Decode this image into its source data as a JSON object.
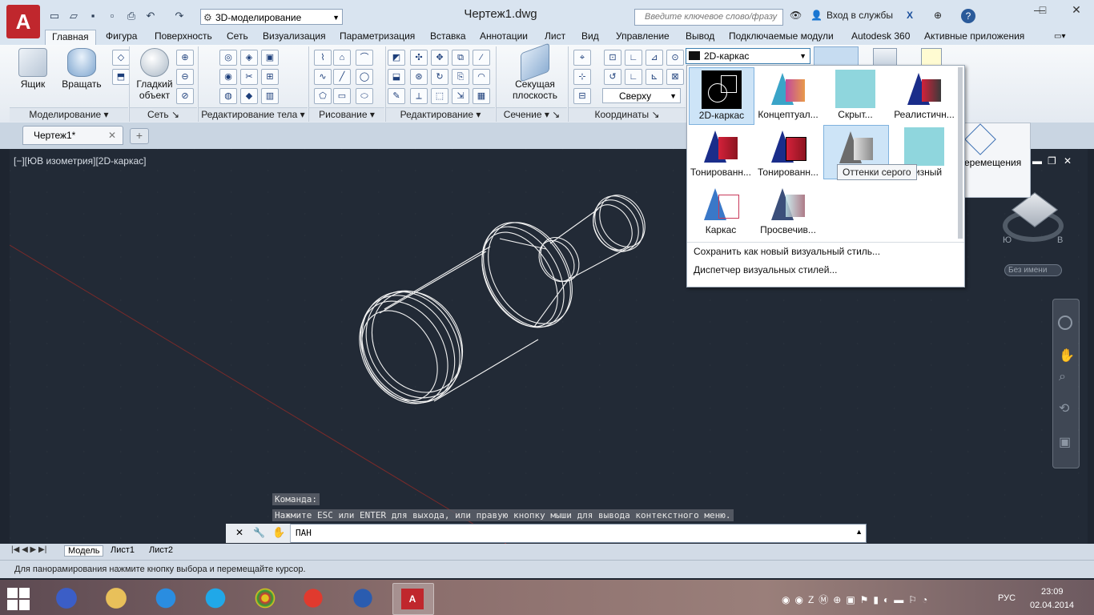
{
  "titlebar": {
    "workspace": "3D-моделирование",
    "doc_title": "Чертеж1.dwg",
    "search_placeholder": "Введите ключевое слово/фразу",
    "signin": "Вход в службы"
  },
  "ribbon_tabs": [
    "Главная",
    "Фигура",
    "Поверхность",
    "Сеть",
    "Визуализация",
    "Параметризация",
    "Вставка",
    "Аннотации",
    "Лист",
    "Вид",
    "Управление",
    "Вывод",
    "Подключаемые модули",
    "Autodesk 360",
    "Активные приложения"
  ],
  "ribbon": {
    "box_label": "Ящик",
    "revolve_label": "Вращать",
    "smooth_label_1": "Гладкий",
    "smooth_label_2": "объект",
    "section_label_1": "Секущая",
    "section_label_2": "плоскость",
    "view_top": "Сверху",
    "panels": [
      "Моделирование",
      "Сеть",
      "Редактирование тела",
      "Рисование",
      "Редактирование",
      "Сечение",
      "Координаты"
    ]
  },
  "doctab": "Чертеж1*",
  "viewport": {
    "label": "[−][ЮВ изометрия][2D-каркас]",
    "viewcube_name": "Без имени"
  },
  "command": {
    "hist1": "Команда:",
    "hist2": "Нажмите ESC или ENTER для выхода, или правую кнопку мыши для вывода контекстного меню.",
    "current": "ПАН"
  },
  "layout_tabs": [
    "Модель",
    "Лист1",
    "Лист2"
  ],
  "status": "Для панорамирования нажмите кнопку выбора и перемещайте курсор.",
  "visual_styles": {
    "current": "2D-каркас",
    "items": [
      "2D-каркас",
      "Концептуал...",
      "Скрыт...",
      "Реалистичн...",
      "Тонированн...",
      "Тонированн...",
      "",
      "...изный",
      "Каркас",
      "Просвечив..."
    ],
    "tooltip": "Оттенки серого",
    "save_new": "Сохранить как новый визуальный стиль...",
    "manager": "Диспетчер визуальных стилей..."
  },
  "gizmo_label": "еремещения",
  "clock": {
    "time": "23:09",
    "date": "02.04.2014",
    "lang": "РУС"
  }
}
